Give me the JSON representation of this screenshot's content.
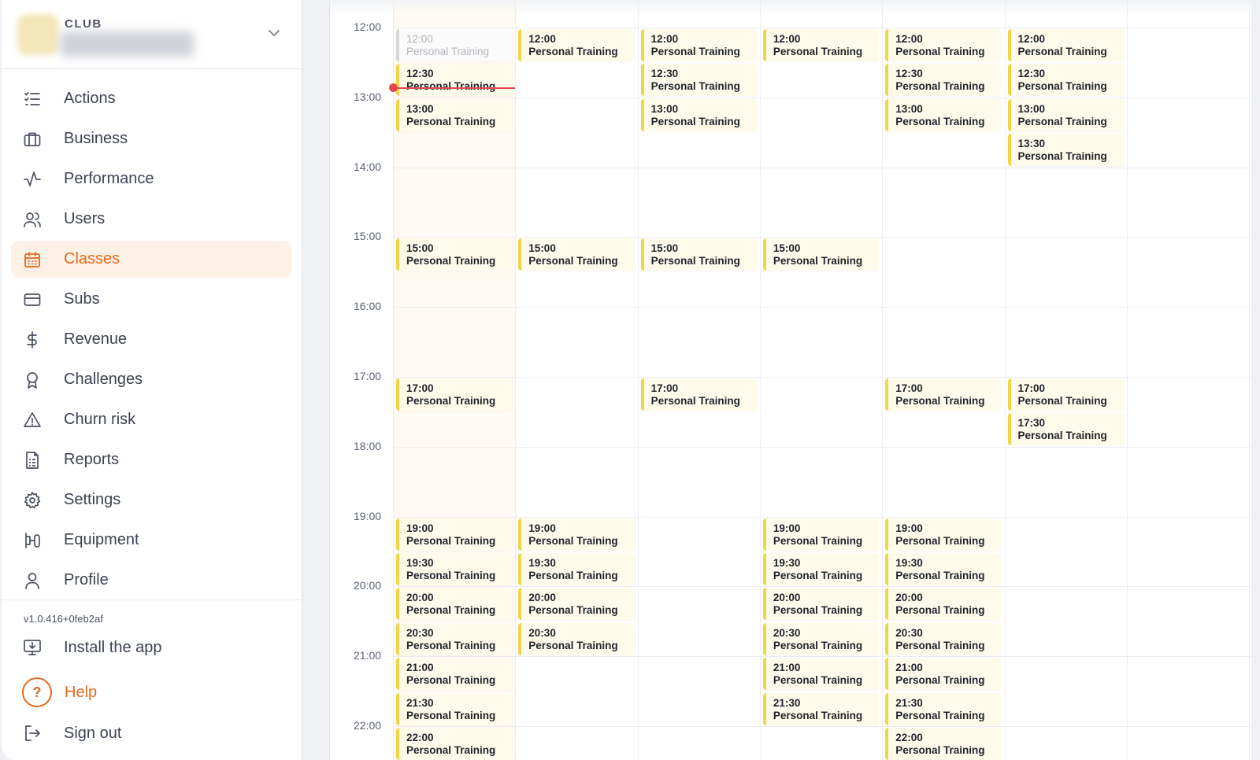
{
  "club": {
    "label": "CLUB"
  },
  "nav": {
    "items": [
      {
        "label": "Actions",
        "icon": "checklist-icon"
      },
      {
        "label": "Business",
        "icon": "briefcase-icon"
      },
      {
        "label": "Performance",
        "icon": "activity-icon"
      },
      {
        "label": "Users",
        "icon": "users-icon"
      },
      {
        "label": "Classes",
        "icon": "calendar-icon",
        "active": true
      },
      {
        "label": "Subs",
        "icon": "credit-card-icon"
      },
      {
        "label": "Revenue",
        "icon": "dollar-icon"
      },
      {
        "label": "Challenges",
        "icon": "award-icon"
      },
      {
        "label": "Churn risk",
        "icon": "warning-icon"
      },
      {
        "label": "Reports",
        "icon": "report-icon"
      },
      {
        "label": "Settings",
        "icon": "gear-icon"
      },
      {
        "label": "Equipment",
        "icon": "equipment-icon"
      },
      {
        "label": "Profile",
        "icon": "profile-icon"
      }
    ]
  },
  "footer": {
    "version": "v1.0.416+0feb2af",
    "install_label": "Install the app",
    "help_label": "Help",
    "help_glyph": "?",
    "signout_label": "Sign out"
  },
  "colors": {
    "accent": "#e5691c",
    "event_bar": "#f2d547",
    "event_bg": "#fffbea",
    "now_line": "#e4474e"
  },
  "calendar": {
    "hours": [
      "12:00",
      "13:00",
      "14:00",
      "15:00",
      "16:00",
      "17:00",
      "18:00",
      "19:00",
      "20:00",
      "21:00",
      "22:00"
    ],
    "current_time": "12:52",
    "days": [
      {
        "events": [
          {
            "time": "12:00",
            "title": "Personal Training",
            "past": true
          },
          {
            "time": "12:30",
            "title": "Personal Training"
          },
          {
            "time": "13:00",
            "title": "Personal Training"
          },
          {
            "time": "15:00",
            "title": "Personal Training"
          },
          {
            "time": "17:00",
            "title": "Personal Training"
          },
          {
            "time": "19:00",
            "title": "Personal Training"
          },
          {
            "time": "19:30",
            "title": "Personal Training"
          },
          {
            "time": "20:00",
            "title": "Personal Training"
          },
          {
            "time": "20:30",
            "title": "Personal Training"
          },
          {
            "time": "21:00",
            "title": "Personal Training"
          },
          {
            "time": "21:30",
            "title": "Personal Training"
          },
          {
            "time": "22:00",
            "title": "Personal Training"
          }
        ]
      },
      {
        "events": [
          {
            "time": "12:00",
            "title": "Personal Training"
          },
          {
            "time": "15:00",
            "title": "Personal Training"
          },
          {
            "time": "19:00",
            "title": "Personal Training"
          },
          {
            "time": "19:30",
            "title": "Personal Training"
          },
          {
            "time": "20:00",
            "title": "Personal Training"
          },
          {
            "time": "20:30",
            "title": "Personal Training"
          }
        ]
      },
      {
        "events": [
          {
            "time": "12:00",
            "title": "Personal Training"
          },
          {
            "time": "12:30",
            "title": "Personal Training"
          },
          {
            "time": "13:00",
            "title": "Personal Training"
          },
          {
            "time": "15:00",
            "title": "Personal Training"
          },
          {
            "time": "17:00",
            "title": "Personal Training"
          }
        ]
      },
      {
        "events": [
          {
            "time": "12:00",
            "title": "Personal Training"
          },
          {
            "time": "15:00",
            "title": "Personal Training"
          },
          {
            "time": "19:00",
            "title": "Personal Training"
          },
          {
            "time": "19:30",
            "title": "Personal Training"
          },
          {
            "time": "20:00",
            "title": "Personal Training"
          },
          {
            "time": "20:30",
            "title": "Personal Training"
          },
          {
            "time": "21:00",
            "title": "Personal Training"
          },
          {
            "time": "21:30",
            "title": "Personal Training"
          }
        ]
      },
      {
        "events": [
          {
            "time": "12:00",
            "title": "Personal Training"
          },
          {
            "time": "12:30",
            "title": "Personal Training"
          },
          {
            "time": "13:00",
            "title": "Personal Training"
          },
          {
            "time": "17:00",
            "title": "Personal Training"
          },
          {
            "time": "19:00",
            "title": "Personal Training"
          },
          {
            "time": "19:30",
            "title": "Personal Training"
          },
          {
            "time": "20:00",
            "title": "Personal Training"
          },
          {
            "time": "20:30",
            "title": "Personal Training"
          },
          {
            "time": "21:00",
            "title": "Personal Training"
          },
          {
            "time": "21:30",
            "title": "Personal Training"
          },
          {
            "time": "22:00",
            "title": "Personal Training"
          }
        ]
      },
      {
        "events": [
          {
            "time": "12:00",
            "title": "Personal Training"
          },
          {
            "time": "12:30",
            "title": "Personal Training"
          },
          {
            "time": "13:00",
            "title": "Personal Training"
          },
          {
            "time": "13:30",
            "title": "Personal Training"
          },
          {
            "time": "17:00",
            "title": "Personal Training"
          },
          {
            "time": "17:30",
            "title": "Personal Training"
          }
        ]
      },
      {
        "events": []
      }
    ]
  }
}
